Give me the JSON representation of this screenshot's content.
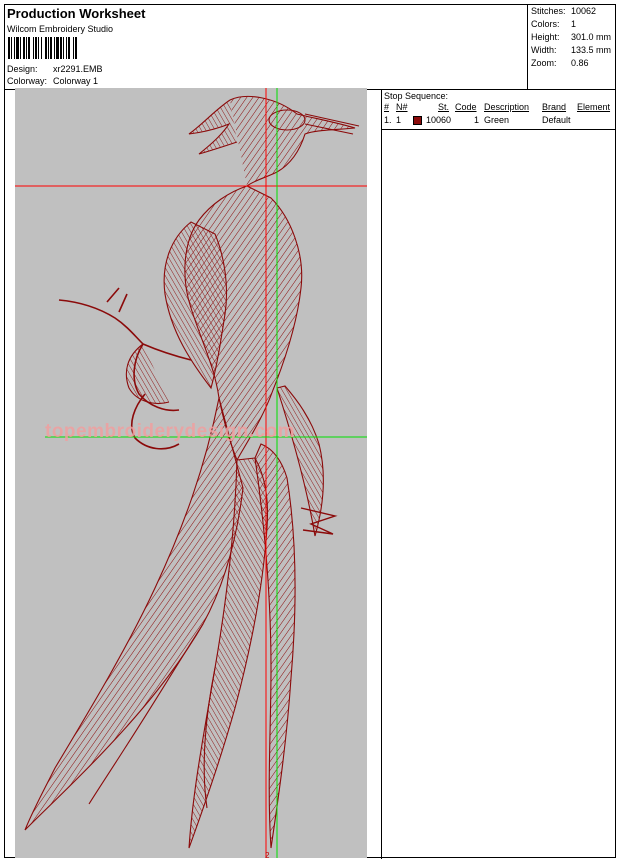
{
  "header": {
    "title": "Production Worksheet",
    "software": "Wilcom  Embroidery Studio",
    "design_label": "Design:",
    "design_value": "xr2291.EMB",
    "colorway_label": "Colorway:",
    "colorway_value": "Colorway 1"
  },
  "stats": [
    {
      "label": "Stitches:",
      "value": "10062"
    },
    {
      "label": "Colors:",
      "value": "1"
    },
    {
      "label": "Height:",
      "value": "301.0 mm"
    },
    {
      "label": "Width:",
      "value": "133.5 mm"
    },
    {
      "label": "Zoom:",
      "value": "0.86"
    }
  ],
  "stop_sequence": {
    "title": "Stop Sequence:",
    "columns": [
      "#",
      "N#",
      "St.",
      "Code",
      "Description",
      "Brand",
      "Element"
    ],
    "rows": [
      {
        "num": "1.",
        "n": "1",
        "swatch_color": "#8b0a0a",
        "stitches": "10060",
        "code": "1",
        "description": "Green",
        "brand": "Default",
        "element": ""
      }
    ]
  },
  "design": {
    "watermark": "topembroiderydesign.com",
    "marker": "2",
    "thread_color": "#8b0a0a",
    "background_color": "#c0c0c0",
    "guide_h_color": "#ff0000",
    "guide_v_color": "#00ff00"
  }
}
